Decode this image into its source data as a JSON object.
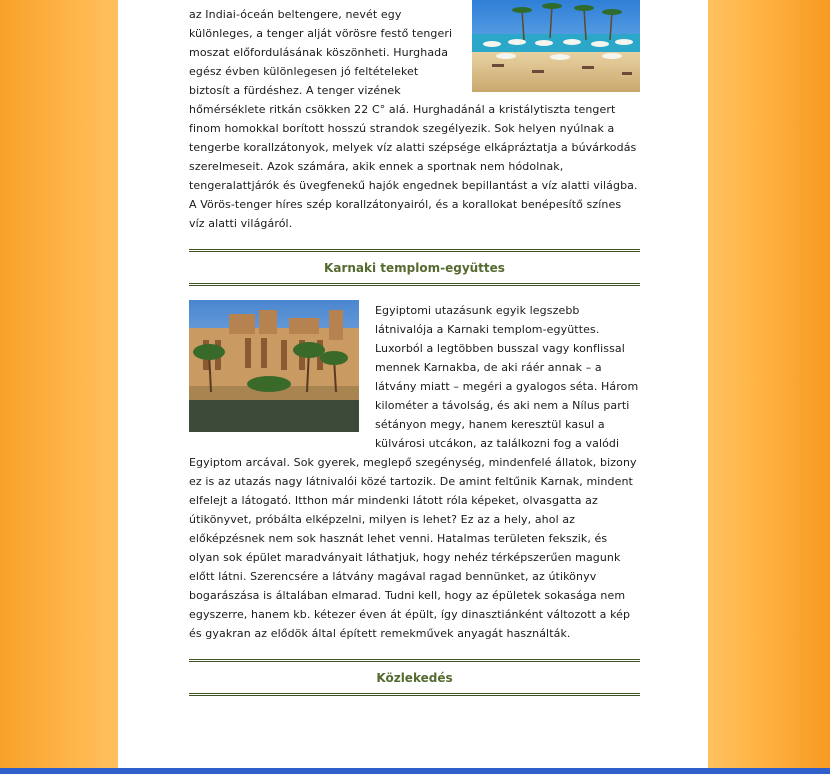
{
  "sections": {
    "intro_paragraph": "az Indiai-óceán beltengere, nevét egy különleges, a tenger alját vörösre festő tengeri moszat előfordulásának köszönheti. Hurghada egész évben különlegesen jó feltételeket biztosít a fürdéshez. A tenger vizének hőmérséklete ritkán csökken 22 C° alá. Hurghadánál a kristálytiszta tengert finom homokkal borított hosszú strandok szegélyezik. Sok helyen nyúlnak a tengerbe korallzátonyok, melyek víz alatti szépsége elkápráztatja a búvárkodás szerelmeseit. Azok számára, akik ennek a sportnak nem hódolnak, tengeralattjárók és üvegfenekű hajók engednek bepillantást a víz alatti világba. A Vörös-tenger híres szép korallzátonyairól, és a korallokat benépesítő színes víz alatti világáról.",
    "karnak_title": "Karnaki templom-együttes",
    "karnak_paragraph": "Egyiptomi utazásunk egyik legszebb látnivalója a Karnaki templom-együttes. Luxorból a legtöbben busszal vagy konflissal mennek Karnakba, de aki ráér annak – a látvány miatt – megéri a gyalogos séta. Három kilométer a távolság, és aki nem a Nílus parti sétányon megy, hanem keresztül kasul a külvárosi utcákon, az találkozni fog a valódi Egyiptom arcával. Sok gyerek, meglepő szegénység, mindenfelé állatok, bizony ez is az utazás nagy látnivalói közé tartozik. De amint feltűnik Karnak, mindent elfelejt a látogató. Itthon már mindenki látott róla képeket, olvasgatta az útikönyvet, próbálta elképzelni, milyen is lehet? Ez az a hely, ahol az előképzésnek nem sok hasznát lehet venni. Hatalmas területen fekszik, és olyan sok épület maradványait láthatjuk, hogy nehéz térképszerűen magunk előtt látni. Szerencsére a látvány magával ragad bennünket, az útikönyv bogarászása is általában elmarad. Tudni kell, hogy az épületek sokasága nem egyszerre, hanem kb. kétezer éven át épült, így dinasztiánként változott a kép és gyakran az elődök által épített remekművek anyagát használták.",
    "transport_title": "Közlekedés"
  },
  "colors": {
    "side_orange": "#ffb347",
    "title_green": "#556b2f",
    "rule_green": "#3f5424"
  }
}
